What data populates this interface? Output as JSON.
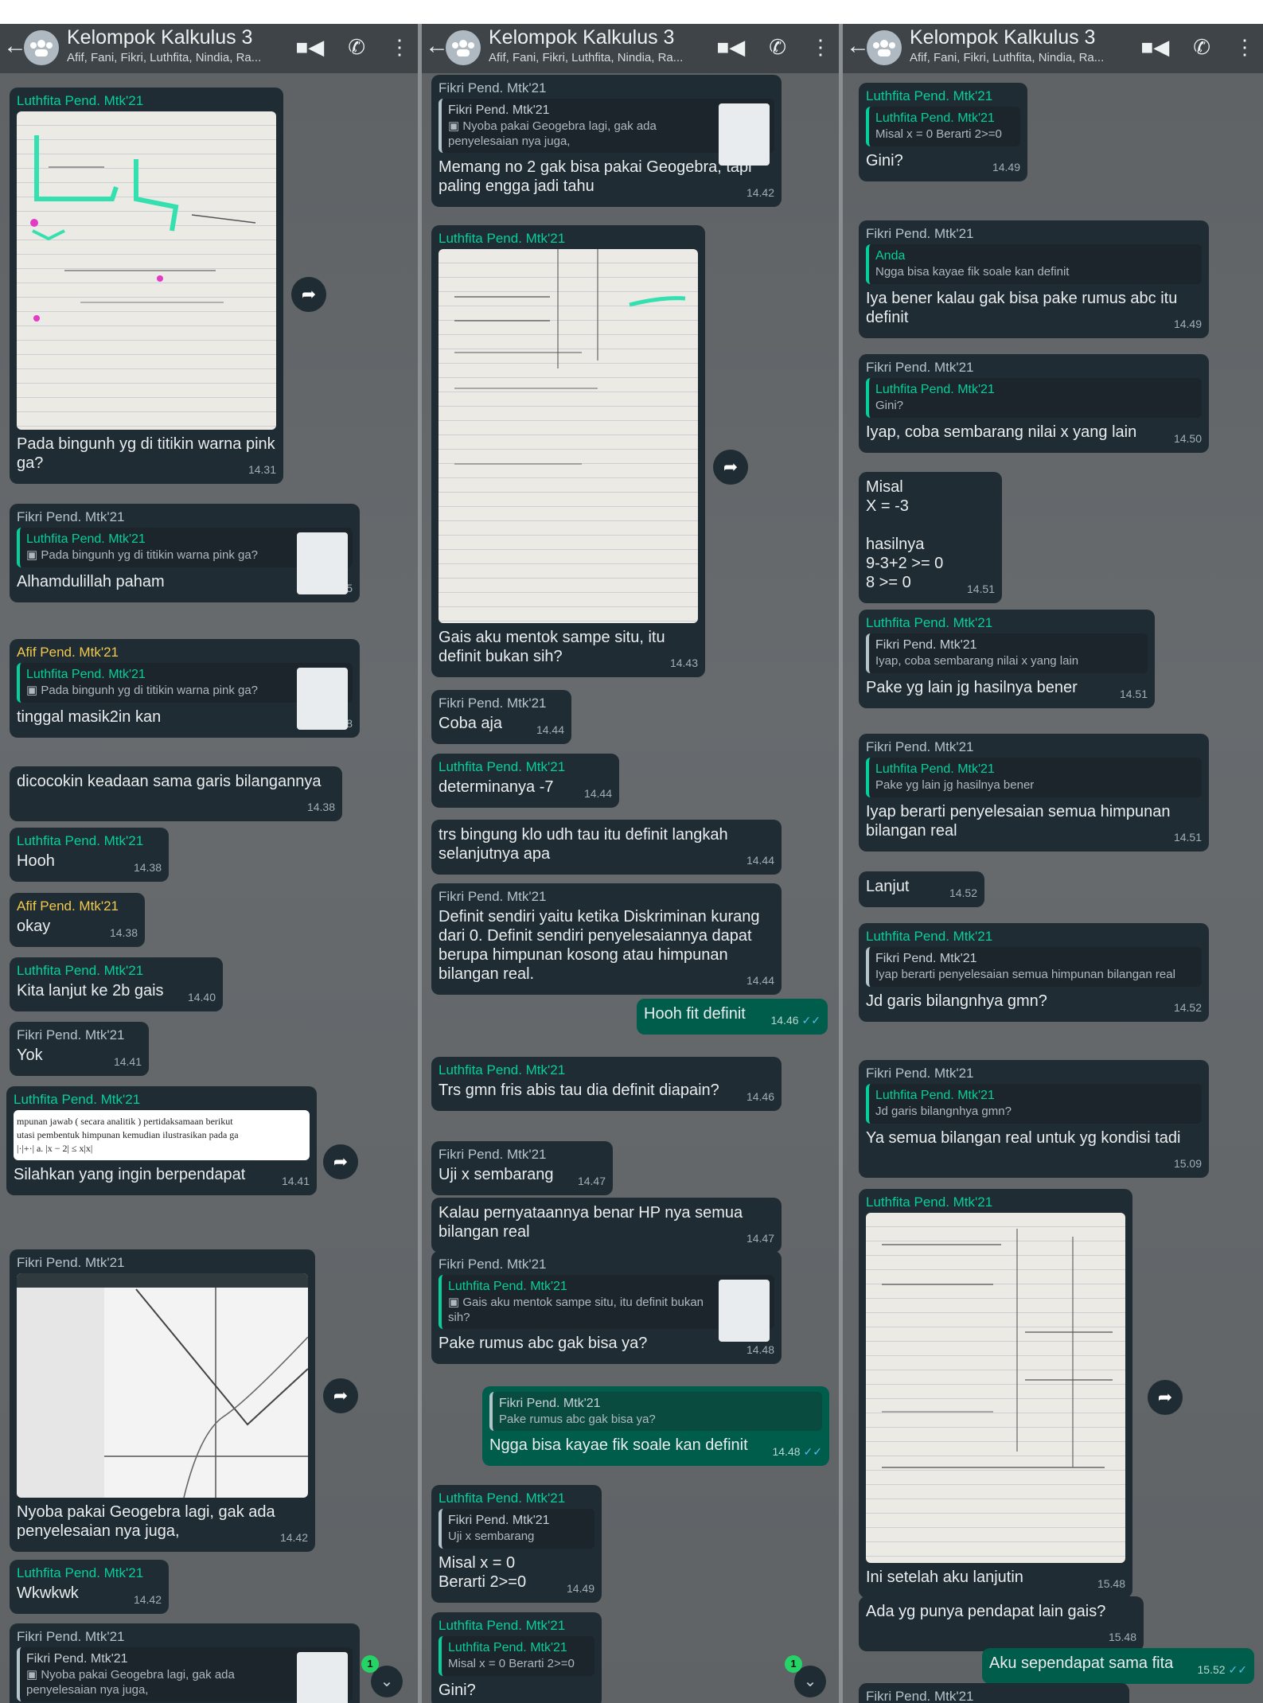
{
  "chat": {
    "title": "Kelompok Kalkulus 3",
    "members": "Afif, Fani, Fikri, Luthfita, Nindia, Ra..."
  },
  "colors": {
    "incoming": "#202c33",
    "outgoing": "#005c4b",
    "background": "#64686b",
    "luthfita": "#06cf9c",
    "afif": "#f2c94c"
  },
  "icons": [
    "back-arrow-icon",
    "group-avatar-icon",
    "video-call-icon",
    "voice-call-icon",
    "more-options-icon",
    "forward-icon",
    "scroll-down-icon",
    "read-receipt-icon",
    "photo-icon"
  ],
  "panel1": {
    "m1": {
      "sender": "Luthfita Pend. Mtk'21",
      "text": "Pada bingunh yg di titikin warna pink ga?",
      "time": "14.31"
    },
    "m2": {
      "sender": "Fikri Pend. Mtk'21",
      "q_name": "Luthfita Pend. Mtk'21",
      "q_text": "Pada bingunh yg di titikin warna pink ga?",
      "text": "Alhamdulillah paham",
      "time": "14.35"
    },
    "m3": {
      "sender": "Afif Pend. Mtk'21",
      "q_name": "Luthfita Pend. Mtk'21",
      "q_text": "Pada bingunh yg di titikin warna pink ga?",
      "text": "tinggal masik2in kan",
      "time": "14.38"
    },
    "m4": {
      "text": "dicocokin keadaan sama garis bilangannya",
      "time": "14.38"
    },
    "m5": {
      "sender": "Luthfita Pend. Mtk'21",
      "text": "Hooh",
      "time": "14.38"
    },
    "m6": {
      "sender": "Afif Pend. Mtk'21",
      "text": "okay",
      "time": "14.38"
    },
    "m7": {
      "sender": "Luthfita Pend. Mtk'21",
      "text": "Kita lanjut ke 2b gais",
      "time": "14.40"
    },
    "m8": {
      "sender": "Fikri Pend. Mtk'21",
      "text": "Yok",
      "time": "14.41"
    },
    "m9": {
      "sender": "Luthfita Pend. Mtk'21",
      "doc_line1": "mpunan jawab ( secara analitik ) pertidaksamaan berikut",
      "doc_line2": "utasi pembentuk himpunan kemudian ilustrasikan pada ga",
      "doc_line3": "|·|+·| a. |x − 2| ≤ x|x|",
      "text": "Silahkan yang ingin berpendapat",
      "time": "14.41"
    },
    "m10": {
      "sender": "Fikri Pend. Mtk'21",
      "text": "Nyoba pakai Geogebra lagi, gak ada penyelesaian nya juga,",
      "time": "14.42"
    },
    "m11": {
      "sender": "Luthfita Pend. Mtk'21",
      "text": "Wkwkwk",
      "time": "14.42"
    },
    "m12": {
      "sender": "Fikri Pend. Mtk'21",
      "q_name": "Fikri Pend. Mtk'21",
      "q_text": "Nyoba pakai Geogebra lagi, gak ada penyelesaian nya juga,"
    },
    "badge": "1"
  },
  "panel2": {
    "m1": {
      "sender": "Fikri Pend. Mtk'21",
      "q_name": "Fikri Pend. Mtk'21",
      "q_text": "Nyoba pakai Geogebra lagi, gak ada penyelesaian nya juga,",
      "text": "Memang no 2 gak bisa pakai Geogebra, tapi paling engga jadi tahu",
      "time": "14.42"
    },
    "m2": {
      "sender": "Luthfita Pend. Mtk'21",
      "text": "Gais aku mentok sampe situ, itu definit bukan sih?",
      "time": "14.43"
    },
    "m3": {
      "sender": "Fikri Pend. Mtk'21",
      "text": "Coba aja",
      "time": "14.44"
    },
    "m4": {
      "sender": "Luthfita Pend. Mtk'21",
      "text": "determinanya -7",
      "time": "14.44"
    },
    "m5": {
      "text": "trs bingung klo udh tau itu definit langkah selanjutnya apa",
      "time": "14.44"
    },
    "m6": {
      "sender": "Fikri Pend. Mtk'21",
      "text": "Definit sendiri yaitu ketika Diskriminan kurang dari 0. Definit sendiri penyelesaiannya dapat berupa himpunan kosong atau himpunan bilangan real.",
      "time": "14.44"
    },
    "m7": {
      "text": "Hooh fit definit",
      "time": "14.46"
    },
    "m8": {
      "sender": "Luthfita Pend. Mtk'21",
      "text": "Trs gmn fris abis tau dia definit diapain?",
      "time": "14.46"
    },
    "m9": {
      "sender": "Fikri Pend. Mtk'21",
      "text": "Uji x sembarang",
      "time": "14.47"
    },
    "m10": {
      "text": "Kalau pernyataannya benar HP nya semua bilangan real",
      "time": "14.47"
    },
    "m11": {
      "sender": "Fikri Pend. Mtk'21",
      "q_name": "Luthfita Pend. Mtk'21",
      "q_text": "Gais aku mentok sampe situ, itu definit bukan sih?",
      "text": "Pake rumus abc gak bisa ya?",
      "time": "14.48"
    },
    "m12": {
      "q_name": "Fikri Pend. Mtk'21",
      "q_text": "Pake rumus abc gak bisa ya?",
      "text": "Ngga bisa kayae fik soale kan definit",
      "time": "14.48"
    },
    "m13": {
      "sender": "Luthfita Pend. Mtk'21",
      "q_name": "Fikri Pend. Mtk'21",
      "q_text": "Uji x sembarang",
      "text": "Misal x = 0\nBerarti 2>=0",
      "time": "14.49"
    },
    "m14": {
      "sender": "Luthfita Pend. Mtk'21",
      "q_name": "Luthfita Pend. Mtk'21",
      "q_text": "Misal x = 0\nBerarti 2>=0",
      "text": "Gini?"
    },
    "badge": "1"
  },
  "panel3": {
    "m1": {
      "sender": "Luthfita Pend. Mtk'21",
      "q_name": "Luthfita Pend. Mtk'21",
      "q_text": "Misal x = 0\nBerarti 2>=0",
      "text": "Gini?",
      "time": "14.49"
    },
    "m2": {
      "sender": "Fikri Pend. Mtk'21",
      "q_name": "Anda",
      "q_text": "Ngga bisa kayae fik soale kan definit",
      "text": "Iya bener kalau gak bisa pake rumus abc itu definit",
      "time": "14.49"
    },
    "m3": {
      "sender": "Fikri Pend. Mtk'21",
      "q_name": "Luthfita Pend. Mtk'21",
      "q_text": "Gini?",
      "text": "Iyap, coba sembarang nilai x yang lain",
      "time": "14.50"
    },
    "m4": {
      "text": "Misal\nX = -3\n\nhasilnya\n9-3+2 >= 0\n8 >= 0",
      "time": "14.51"
    },
    "m5": {
      "sender": "Luthfita Pend. Mtk'21",
      "q_name": "Fikri Pend. Mtk'21",
      "q_text": "Iyap, coba sembarang nilai x yang lain",
      "text": "Pake yg lain jg hasilnya bener",
      "time": "14.51"
    },
    "m6": {
      "sender": "Fikri Pend. Mtk'21",
      "q_name": "Luthfita Pend. Mtk'21",
      "q_text": "Pake yg lain jg hasilnya bener",
      "text": "Iyap berarti penyelesaian semua himpunan bilangan real",
      "time": "14.51"
    },
    "m7": {
      "text": "Lanjut",
      "time": "14.52"
    },
    "m8": {
      "sender": "Luthfita Pend. Mtk'21",
      "q_name": "Fikri Pend. Mtk'21",
      "q_text": "Iyap berarti penyelesaian semua himpunan bilangan real",
      "text": "Jd garis bilangnhya gmn?",
      "time": "14.52"
    },
    "m9": {
      "sender": "Fikri Pend. Mtk'21",
      "q_name": "Luthfita Pend. Mtk'21",
      "q_text": "Jd garis bilangnhya gmn?",
      "text": "Ya semua bilangan real untuk yg kondisi tadi",
      "time": "15.09"
    },
    "m10": {
      "sender": "Luthfita Pend. Mtk'21",
      "text": "Ini setelah aku lanjutin",
      "time": "15.48"
    },
    "m11": {
      "text": "Ada yg punya pendapat lain gais?",
      "time": "15.48"
    },
    "m12": {
      "text": "Aku sependapat sama fita",
      "time": "15.52"
    },
    "m13": {
      "sender": "Fikri Pend. Mtk'21"
    }
  }
}
